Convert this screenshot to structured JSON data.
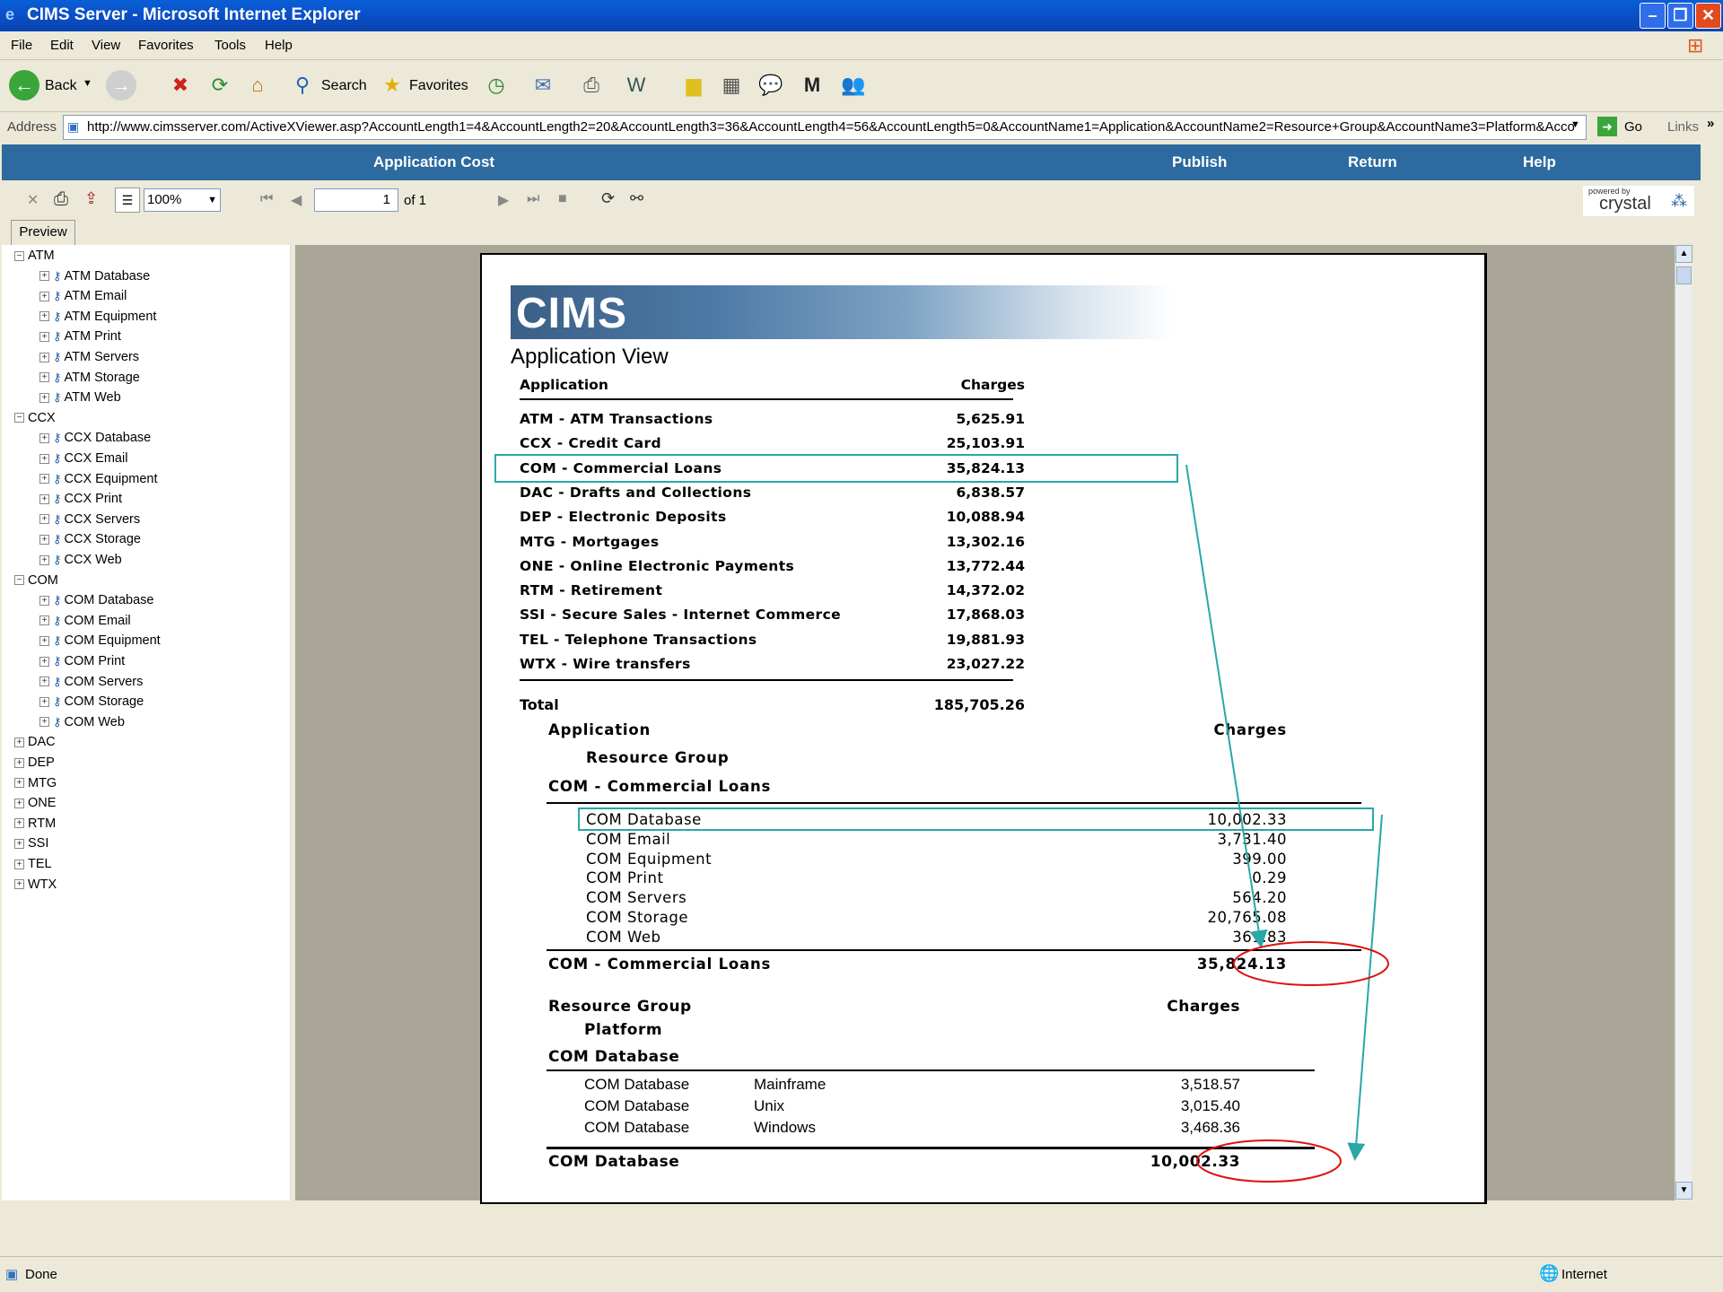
{
  "window": {
    "title": "CIMS Server - Microsoft Internet Explorer"
  },
  "menu": [
    "File",
    "Edit",
    "View",
    "Favorites",
    "Tools",
    "Help"
  ],
  "toolbar": {
    "back": "Back",
    "search": "Search",
    "favorites": "Favorites"
  },
  "address": {
    "label": "Address",
    "url": "http://www.cimsserver.com/ActiveXViewer.asp?AccountLength1=4&AccountLength2=20&AccountLength3=36&AccountLength4=56&AccountLength5=0&AccountName1=Application&AccountName2=Resource+Group&AccountName3=Platform&Acco",
    "go": "Go",
    "links": "Links"
  },
  "appbar": {
    "title": "Application Cost",
    "publish": "Publish",
    "return": "Return",
    "help": "Help"
  },
  "viewer": {
    "zoom": "100%",
    "page": "1",
    "of": "of 1",
    "powered": "powered by",
    "crystal": "crystal",
    "tab": "Preview"
  },
  "tree": [
    {
      "label": "ATM",
      "expanded": true,
      "children": [
        "ATM Database",
        "ATM Email",
        "ATM Equipment",
        "ATM Print",
        "ATM Servers",
        "ATM Storage",
        "ATM Web"
      ]
    },
    {
      "label": "CCX",
      "expanded": true,
      "children": [
        "CCX Database",
        "CCX Email",
        "CCX Equipment",
        "CCX Print",
        "CCX Servers",
        "CCX Storage",
        "CCX Web"
      ]
    },
    {
      "label": "COM",
      "expanded": true,
      "children": [
        "COM Database",
        "COM Email",
        "COM Equipment",
        "COM Print",
        "COM Servers",
        "COM Storage",
        "COM Web"
      ]
    },
    {
      "label": "DAC",
      "expanded": false,
      "children": []
    },
    {
      "label": "DEP",
      "expanded": false,
      "children": []
    },
    {
      "label": "MTG",
      "expanded": false,
      "children": []
    },
    {
      "label": "ONE",
      "expanded": false,
      "children": []
    },
    {
      "label": "RTM",
      "expanded": false,
      "children": []
    },
    {
      "label": "SSI",
      "expanded": false,
      "children": []
    },
    {
      "label": "TEL",
      "expanded": false,
      "children": []
    },
    {
      "label": "WTX",
      "expanded": false,
      "children": []
    }
  ],
  "report": {
    "logo": "CIMS",
    "title": "Application View",
    "col_application": "Application",
    "col_charges": "Charges",
    "rows": [
      {
        "name": "ATM - ATM Transactions",
        "charges": "5,625.91"
      },
      {
        "name": "CCX - Credit Card",
        "charges": "25,103.91"
      },
      {
        "name": "COM - Commercial Loans",
        "charges": "35,824.13"
      },
      {
        "name": "DAC - Drafts and Collections",
        "charges": "6,838.57"
      },
      {
        "name": "DEP - Electronic Deposits",
        "charges": "10,088.94"
      },
      {
        "name": "MTG - Mortgages",
        "charges": "13,302.16"
      },
      {
        "name": "ONE - Online Electronic Payments",
        "charges": "13,772.44"
      },
      {
        "name": "RTM - Retirement",
        "charges": "14,372.02"
      },
      {
        "name": "SSI - Secure Sales - Internet Commerce",
        "charges": "17,868.03"
      },
      {
        "name": "TEL - Telephone Transactions",
        "charges": "19,881.93"
      },
      {
        "name": "WTX - Wire transfers",
        "charges": "23,027.22"
      }
    ],
    "total_label": "Total",
    "total": "185,705.26",
    "sub1": {
      "col_application": "Application",
      "col_charges": "Charges",
      "col_group": "Resource Group",
      "heading": "COM - Commercial Loans",
      "rows": [
        {
          "name": "COM Database",
          "charges": "10,002.33"
        },
        {
          "name": "COM Email",
          "charges": "3,731.40"
        },
        {
          "name": "COM Equipment",
          "charges": "399.00"
        },
        {
          "name": "COM Print",
          "charges": "0.29"
        },
        {
          "name": "COM Servers",
          "charges": "564.20"
        },
        {
          "name": "COM Storage",
          "charges": "20,765.08"
        },
        {
          "name": "COM Web",
          "charges": "361.83"
        }
      ],
      "footer_label": "COM - Commercial Loans",
      "footer_total": "35,824.13"
    },
    "sub2": {
      "col_group": "Resource Group",
      "col_charges": "Charges",
      "col_platform": "Platform",
      "heading": "COM Database",
      "rows": [
        {
          "name": "COM Database",
          "platform": "Mainframe",
          "charges": "3,518.57"
        },
        {
          "name": "COM Database",
          "platform": "Unix",
          "charges": "3,015.40"
        },
        {
          "name": "COM Database",
          "platform": "Windows",
          "charges": "3,468.36"
        }
      ],
      "footer_label": "COM Database",
      "footer_total": "10,002.33"
    }
  },
  "status": {
    "text": "Done",
    "zone": "Internet"
  },
  "colors": {
    "titlebar": "#0b4fc7",
    "appbar": "#2c6aa0",
    "highlight_box": "#2aa7a7",
    "circle": "#e01010",
    "viewer_bg": "#a9a698"
  }
}
